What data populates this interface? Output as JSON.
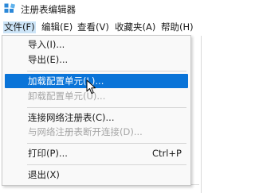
{
  "window": {
    "title": "注册表编辑器",
    "icon": "registry-editor-icon"
  },
  "menubar": {
    "items": [
      {
        "label": "文件(F)",
        "active": true
      },
      {
        "label": "编辑(E)",
        "active": false
      },
      {
        "label": "查看(V)",
        "active": false
      },
      {
        "label": "收藏夹(A)",
        "active": false
      },
      {
        "label": "帮助(H)",
        "active": false
      }
    ]
  },
  "file_menu": {
    "items": [
      {
        "label": "导入(I)...",
        "enabled": true
      },
      {
        "label": "导出(E)...",
        "enabled": true
      },
      {
        "label": "加载配置单元(L)...",
        "enabled": true,
        "highlighted": true
      },
      {
        "label": "卸载配置单元(U)...",
        "enabled": false
      },
      {
        "label": "连接网络注册表(C)...",
        "enabled": true
      },
      {
        "label": "与网络注册表断开连接(D)...",
        "enabled": false
      },
      {
        "label": "打印(P)...",
        "enabled": true,
        "shortcut": "Ctrl+P"
      },
      {
        "label": "退出(X)",
        "enabled": true
      }
    ]
  },
  "colors": {
    "highlight": "#0a74d8",
    "menubar_active": "#cce4f7",
    "disabled_text": "#a6a6a6"
  }
}
